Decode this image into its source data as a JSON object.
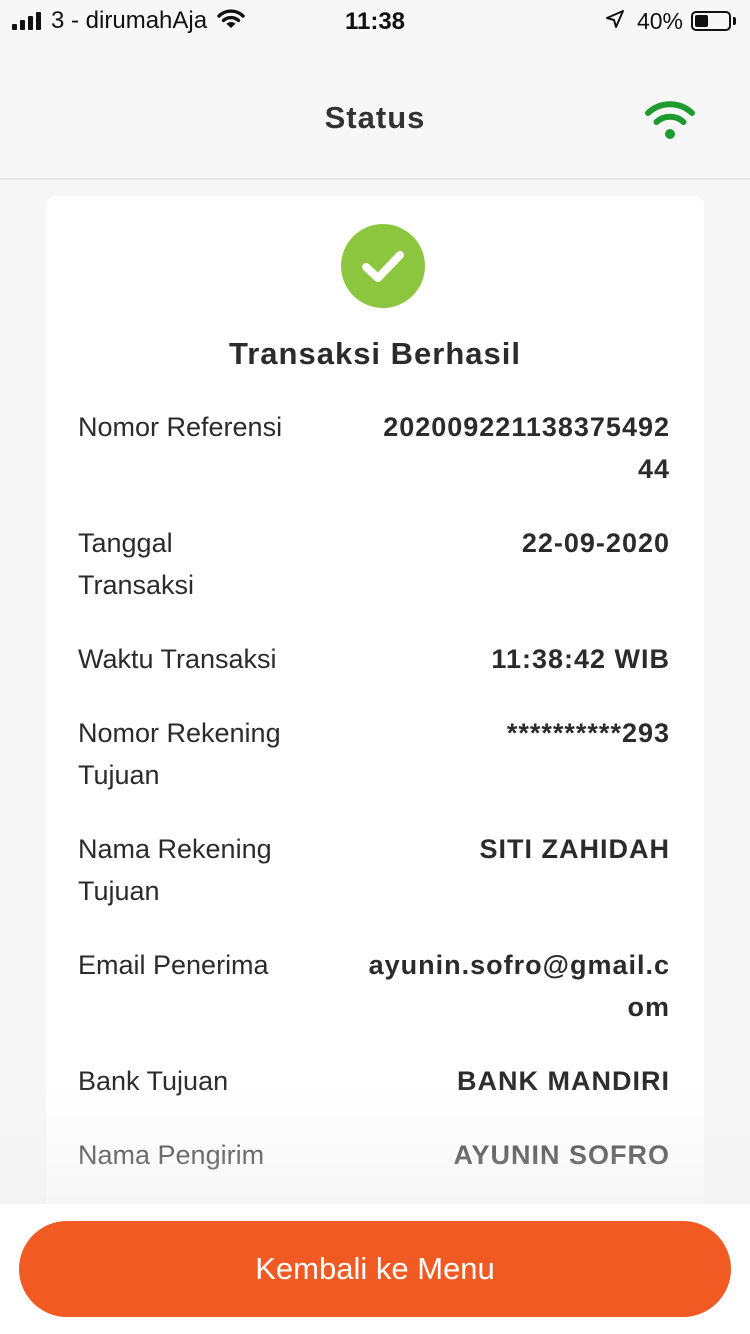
{
  "status_bar": {
    "carrier": "3 - dirumahAja",
    "time": "11:38",
    "battery": "40%",
    "battery_level": 0.4
  },
  "header": {
    "title": "Status",
    "connection_icon": "wifi-icon",
    "accent_color": "#1e9b2e"
  },
  "card": {
    "status_icon": "check-icon",
    "status_color": "#8cc63f",
    "title": "Transaksi Berhasil",
    "rows": [
      {
        "label": "Nomor Referensi",
        "value": "20200922113837549244"
      },
      {
        "label": "Tanggal Transaksi",
        "value": "22-09-2020"
      },
      {
        "label": "Waktu Transaksi",
        "value": "11:38:42 WIB"
      },
      {
        "label": "Nomor Rekening Tujuan",
        "value": "**********293"
      },
      {
        "label": "Nama Rekening Tujuan",
        "value": "SITI ZAHIDAH"
      },
      {
        "label": "Email Penerima",
        "value": "ayunin.sofro@gmail.com"
      },
      {
        "label": "Bank Tujuan",
        "value": "BANK MANDIRI"
      },
      {
        "label": "Nama Pengirim",
        "value": "AYUNIN SOFRO"
      }
    ]
  },
  "footer": {
    "button_label": "Kembali ke Menu",
    "button_color": "#f15a22"
  }
}
